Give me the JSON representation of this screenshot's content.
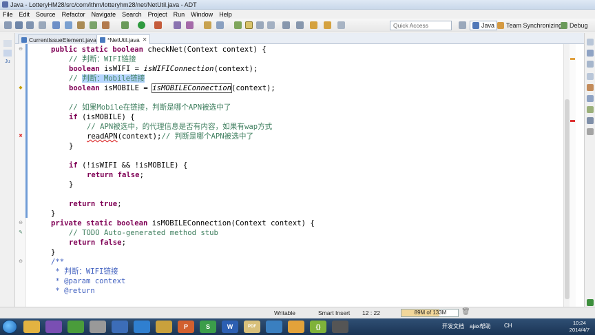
{
  "window": {
    "title": "Java - LotteryHM28/src/com/ithm/lotteryhm28/net/NetUtil.java - ADT"
  },
  "menu": [
    "File",
    "Edit",
    "Source",
    "Refactor",
    "Navigate",
    "Search",
    "Project",
    "Run",
    "Window",
    "Help"
  ],
  "toolbar": {
    "quick_access_placeholder": "Quick Access",
    "perspectives": [
      {
        "label": "Java",
        "active": true
      },
      {
        "label": "Team Synchronizing",
        "active": false
      },
      {
        "label": "Debug",
        "active": false
      }
    ]
  },
  "tabs": [
    {
      "label": "CurrentIssueElement.java",
      "active": false
    },
    {
      "label": "*NetUtil.java",
      "active": true
    }
  ],
  "tab_close_glyph": "✕",
  "lefttrim": {
    "items": [
      "Ju"
    ]
  },
  "code": {
    "l1": {
      "k1": "public",
      "k2": "static",
      "k3": "boolean",
      "t": " checkNet(Context context) {"
    },
    "l2": "// 判断：WIFI链接",
    "l3": {
      "k": "boolean",
      "t": " isWIFI = ",
      "i": "isWIFIConnection",
      "t2": "(context);"
    },
    "l4": {
      "c1": "// ",
      "c2": "判断：Mobile链接"
    },
    "l5": {
      "k": "boolean",
      "t": " isMOBILE = ",
      "i": "isMOBILEConnection",
      "t2": "(context);"
    },
    "l7": "// 如果Mobile在链接，判断是哪个APN被选中了",
    "l8": {
      "k": "if",
      "t": " (isMOBILE) {"
    },
    "l9": "// APN被选中，的代理信息是否有内容，如果有wap方式",
    "l10": {
      "s": "readAPN",
      "t": "(context);",
      "c": "// 判断是哪个APN被选中了"
    },
    "l11": "}",
    "l13": {
      "k": "if",
      "t": " (!isWIFI && !isMOBILE) {"
    },
    "l14": {
      "k1": "return",
      "k2": "false",
      "t": ";"
    },
    "l15": "}",
    "l17": {
      "k1": "return",
      "k2": "true",
      "t": ";"
    },
    "l18": "}",
    "l19": {
      "k1": "private",
      "k2": "static",
      "k3": "boolean",
      "t": " isMOBILEConnection(Context context) {"
    },
    "l20": "// TODO Auto-generated method stub",
    "l21": {
      "k1": "return",
      "k2": "false",
      "t": ";"
    },
    "l22": "}",
    "l23": "/**",
    "l24": " * 判断：WIFI链接",
    "l25": " * @param context",
    "l26": " * @return"
  },
  "status": {
    "writable": "Writable",
    "insert_mode": "Smart Insert",
    "position": "12 : 22",
    "heap": "89M of 133M",
    "heap_fraction": 0.67
  },
  "taskbar": {
    "tray_label_1": "开发文档",
    "tray_label_2": "ajax帮助",
    "ime": "CH",
    "time": "10:24",
    "date": "2014/4/7",
    "apps": [
      {
        "icon": "explorer-icon",
        "color": "#e3b341",
        "label": ""
      },
      {
        "icon": "media-icon",
        "color": "#7a4fb3",
        "label": ""
      },
      {
        "icon": "browser-icon",
        "color": "#4a9c3b",
        "label": ""
      },
      {
        "icon": "tool-icon",
        "color": "#999999",
        "label": ""
      },
      {
        "icon": "globe-icon",
        "color": "#3c6db8",
        "label": ""
      },
      {
        "icon": "ie-icon",
        "color": "#2f7fd0",
        "label": ""
      },
      {
        "icon": "chart-icon",
        "color": "#c9a13c",
        "label": ""
      },
      {
        "icon": "powerpoint-icon",
        "color": "#d2602f",
        "label": "P"
      },
      {
        "icon": "sheet-icon",
        "color": "#3b9d4a",
        "label": "S"
      },
      {
        "icon": "word-icon",
        "color": "#2c5fb2",
        "label": "W"
      },
      {
        "icon": "pdf-icon",
        "color": "#d8c07a",
        "label": "PDF"
      },
      {
        "icon": "screen-icon",
        "color": "#3a7fc0",
        "label": ""
      },
      {
        "icon": "chrome-icon",
        "color": "#e2a23a",
        "label": ""
      },
      {
        "icon": "brackets-icon",
        "color": "#7fb23a",
        "label": "{}"
      },
      {
        "icon": "terminal-icon",
        "color": "#555555",
        "label": ""
      }
    ]
  }
}
